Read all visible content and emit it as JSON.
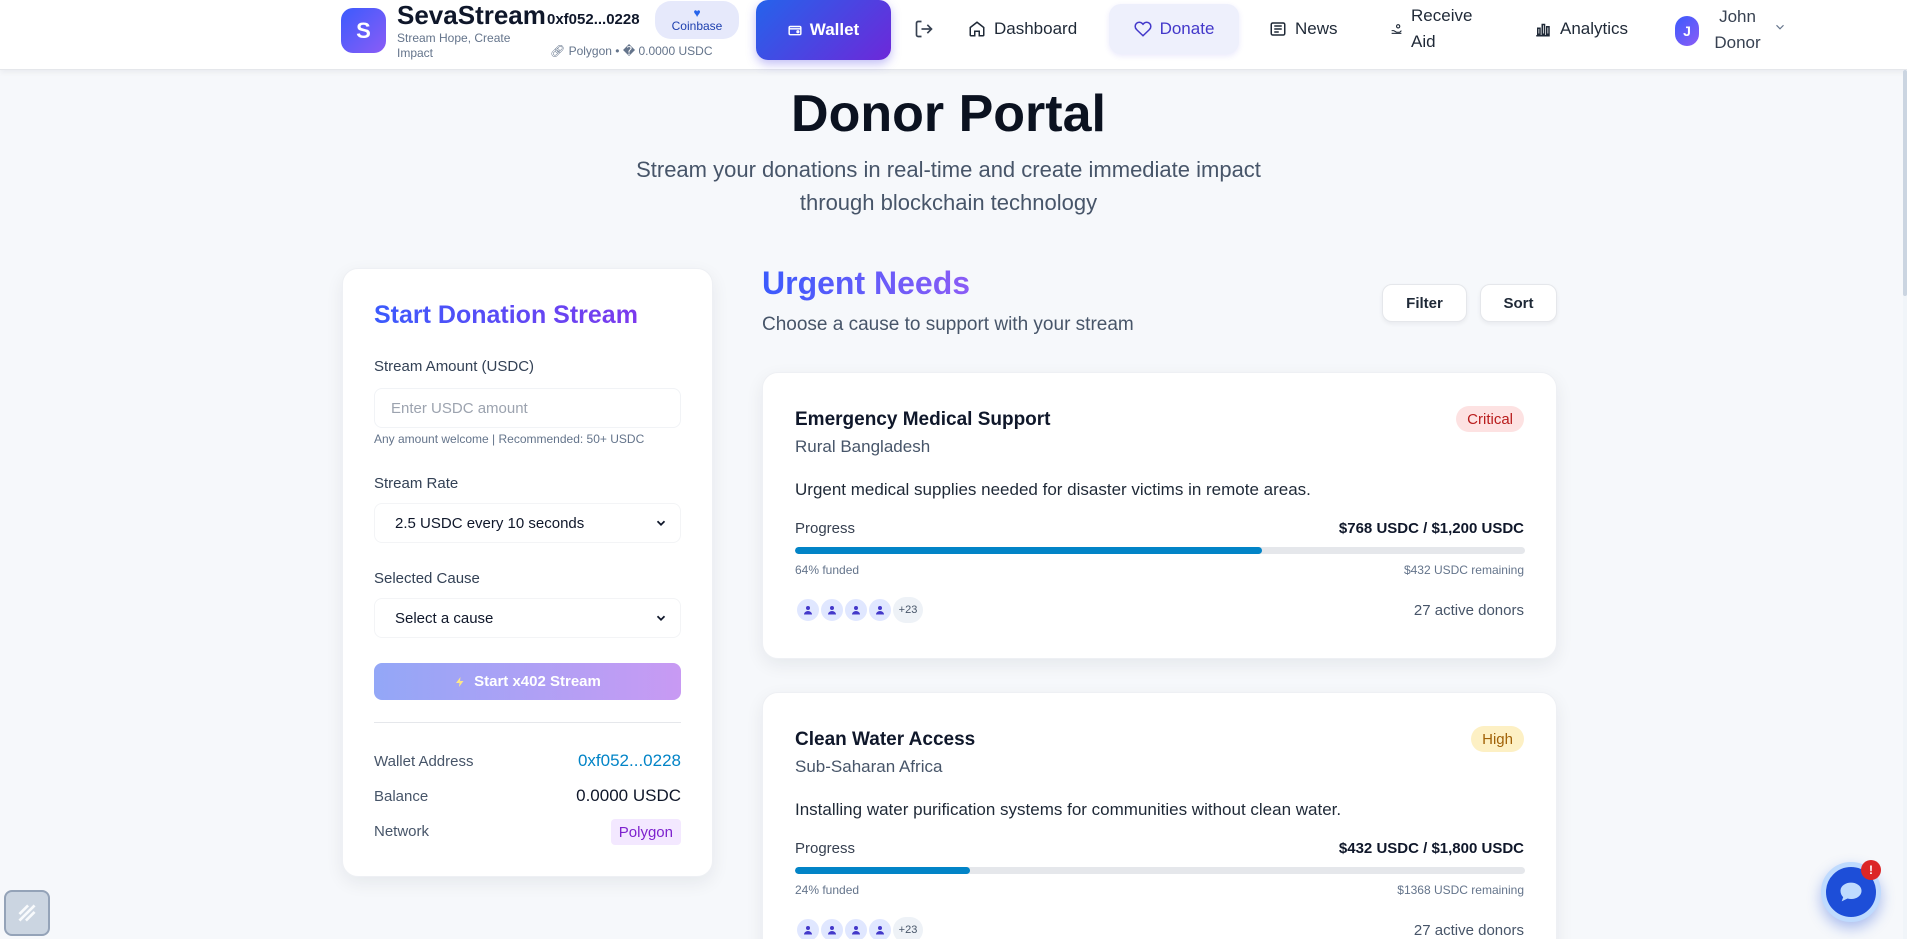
{
  "nav": {
    "logo_letter": "S",
    "brand": "SevaStream",
    "tagline": "Stream Hope, Create Impact",
    "wallet_address": "0xf052...0228",
    "wallet_provider": "Coinbase",
    "network_info": "Polygon • � 0.0000 USDC",
    "wallet_button": "Wallet",
    "items": [
      {
        "label": "Dashboard",
        "icon": "home-icon"
      },
      {
        "label": "Donate",
        "icon": "heart-icon"
      },
      {
        "label": "News",
        "icon": "newspaper-icon"
      },
      {
        "label": "Receive Aid",
        "icon": "hand-coins-icon"
      },
      {
        "label": "Analytics",
        "icon": "bar-chart-icon"
      }
    ],
    "user_initial": "J",
    "user_name": "John Donor"
  },
  "hero": {
    "title": "Donor Portal",
    "subtitle": "Stream your donations in real-time and create immediate impact through blockchain technology"
  },
  "donation_form": {
    "title": "Start Donation Stream",
    "amount_label": "Stream Amount (USDC)",
    "amount_value": "",
    "amount_placeholder": "Enter USDC amount",
    "amount_hint": "Any amount welcome | Recommended: 50+ USDC",
    "rate_label": "Stream Rate",
    "rate_value": "2.5 USDC every 10 seconds",
    "cause_label": "Selected Cause",
    "cause_value": "Select a cause",
    "start_button": "Start x402 Stream",
    "wallet_label": "Wallet Address",
    "wallet_value": "0xf052...0228",
    "balance_label": "Balance",
    "balance_value": "0.0000 USDC",
    "network_label": "Network",
    "network_value": "Polygon"
  },
  "urgent": {
    "title": "Urgent Needs",
    "subtitle": "Choose a cause to support with your stream",
    "filter_button": "Filter",
    "sort_button": "Sort",
    "causes": [
      {
        "title": "Emergency Medical Support",
        "location": "Rural Bangladesh",
        "urgency": "Critical",
        "description": "Urgent medical supplies needed for disaster victims in remote areas.",
        "progress_label": "Progress",
        "amount": "$768 USDC / $1,200 USDC",
        "progress_percent": 64,
        "funded": "64% funded",
        "remaining": "$432 USDC remaining",
        "donor_more": "+23",
        "active_donors": "27 active donors"
      },
      {
        "title": "Clean Water Access",
        "location": "Sub-Saharan Africa",
        "urgency": "High",
        "description": "Installing water purification systems for communities without clean water.",
        "progress_label": "Progress",
        "amount": "$432 USDC / $1,800 USDC",
        "progress_percent": 24,
        "funded": "24% funded",
        "remaining": "$1368 USDC remaining",
        "donor_more": "+23",
        "active_donors": "27 active donors"
      }
    ]
  },
  "chat": {
    "badge": "!"
  },
  "colors": {
    "accent": "#4f46e5",
    "progress": "#0284c7",
    "critical": "#b91c1c",
    "high": "#a16207"
  }
}
